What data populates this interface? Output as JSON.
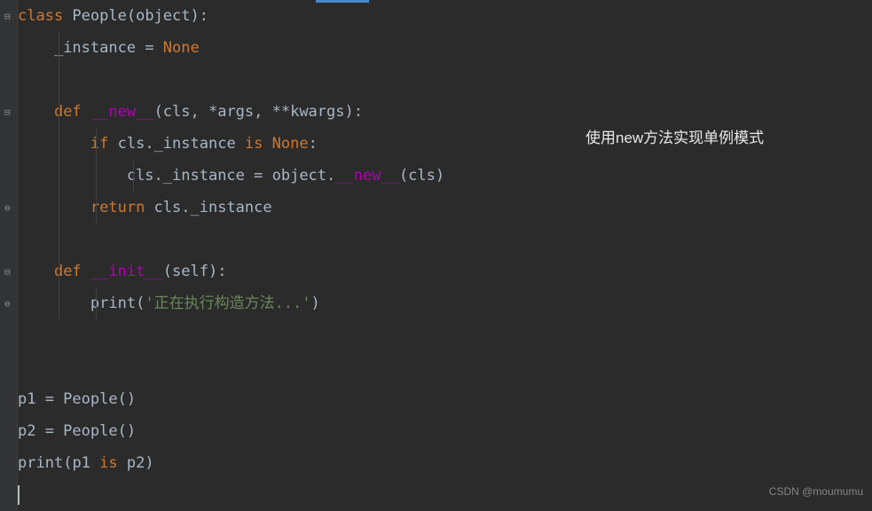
{
  "code": {
    "line1": {
      "kw1": "class ",
      "name": "People",
      "paren1": "(",
      "arg": "object",
      "paren2": "):"
    },
    "line2": {
      "indent": "    ",
      "var": "_instance",
      "eq": " = ",
      "val": "None"
    },
    "line4": {
      "indent": "    ",
      "kw": "def ",
      "name": "__new__",
      "params": "(cls, *args, **kwargs):"
    },
    "line5": {
      "indent": "        ",
      "kw1": "if ",
      "obj": "cls",
      "dot": "._instance ",
      "kw2": "is ",
      "val": "None",
      "colon": ":"
    },
    "line6": {
      "indent": "            ",
      "obj": "cls",
      "dot1": "._instance = ",
      "obj2": "object",
      "dot2": ".",
      "method": "__new__",
      "args": "(cls)"
    },
    "line7": {
      "indent": "        ",
      "kw": "return ",
      "obj": "cls",
      "attr": "._instance"
    },
    "line9": {
      "indent": "    ",
      "kw": "def ",
      "name": "__init__",
      "params": "(self):"
    },
    "line10": {
      "indent": "        ",
      "fn": "print",
      "paren1": "(",
      "str": "'正在执行构造方法...'",
      "paren2": ")"
    },
    "line13": {
      "var": "p1 = People()"
    },
    "line14": {
      "var": "p2 = People()"
    },
    "line15": {
      "fn": "print",
      "paren1": "(",
      "arg1": "p1 ",
      "kw": "is ",
      "arg2": "p2",
      "paren2": ")"
    }
  },
  "annotation": "使用new方法实现单例模式",
  "watermark": "CSDN @moumumu"
}
